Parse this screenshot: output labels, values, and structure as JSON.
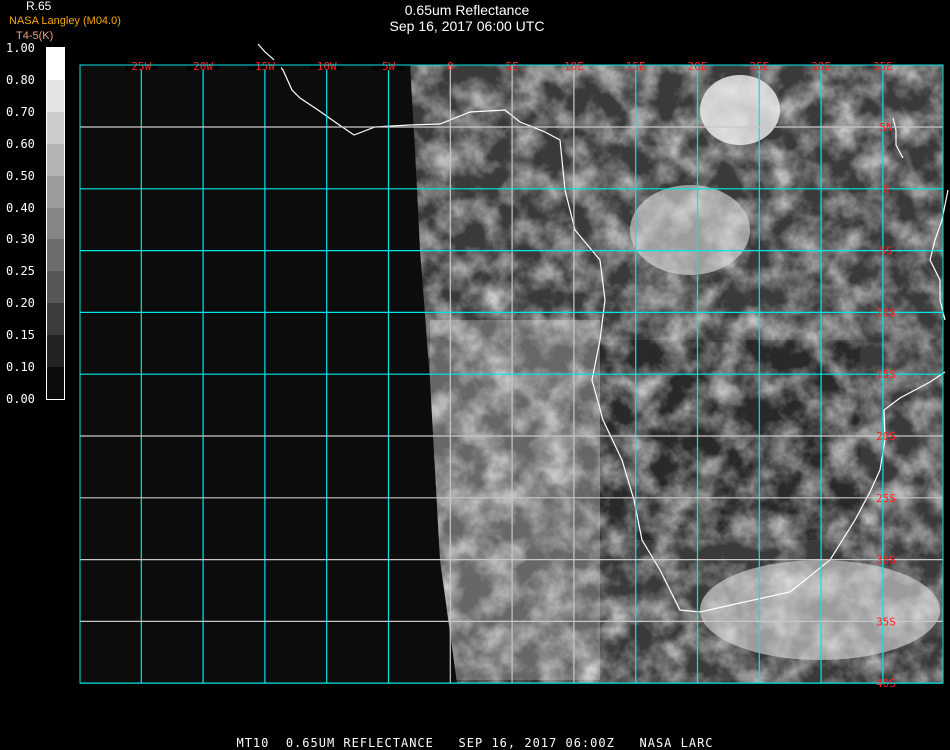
{
  "header": {
    "title": "0.65um Reflectance",
    "subtitle": "Sep 16, 2017 06:00 UTC",
    "organization": "NASA Langley (M04.0)",
    "product_label": "R.65",
    "units_label": "T4-5(K)"
  },
  "legend": {
    "ticks": [
      "1.00",
      "0.80",
      "0.70",
      "0.60",
      "0.50",
      "0.40",
      "0.30",
      "0.25",
      "0.20",
      "0.15",
      "0.10",
      "0.00"
    ],
    "colors": [
      "#ffffff",
      "#e4e4e4",
      "#cccccc",
      "#b3b3b3",
      "#9c9c9c",
      "#858585",
      "#6c6c6c",
      "#575757",
      "#3c3c3c",
      "#222222",
      "#0c0c0c"
    ]
  },
  "map": {
    "longitude_labels": [
      "25W",
      "20W",
      "15W",
      "10W",
      "5W",
      "0",
      "5E",
      "10E",
      "15E",
      "20E",
      "25E",
      "30E",
      "35E"
    ],
    "latitude_labels": [
      "5N",
      "0",
      "5S",
      "10S",
      "15S",
      "20S",
      "25S",
      "30S",
      "35S",
      "40S"
    ],
    "grid_color": "#00e8e8",
    "label_color": "#ff2020"
  },
  "footer": {
    "text": "MT10  0.65UM REFLECTANCE   SEP 16, 2017 06:00Z   NASA LARC"
  }
}
